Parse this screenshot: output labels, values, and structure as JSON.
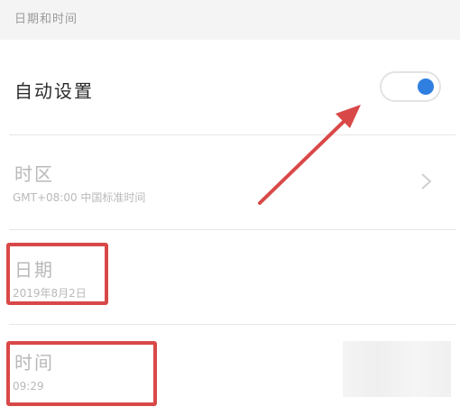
{
  "section_header": {
    "label": "日期和时间"
  },
  "auto_setting": {
    "label": "自动设置",
    "enabled": true
  },
  "time_zone": {
    "label": "时区",
    "value": "GMT+08:00 中国标准时间"
  },
  "date": {
    "label": "日期",
    "value": "2019年8月2日"
  },
  "time": {
    "label": "时间",
    "value": "09:29"
  },
  "colors": {
    "accent": "#2f7fe0",
    "annotation": "#d94848",
    "disabled_text": "#b9b9b9"
  }
}
